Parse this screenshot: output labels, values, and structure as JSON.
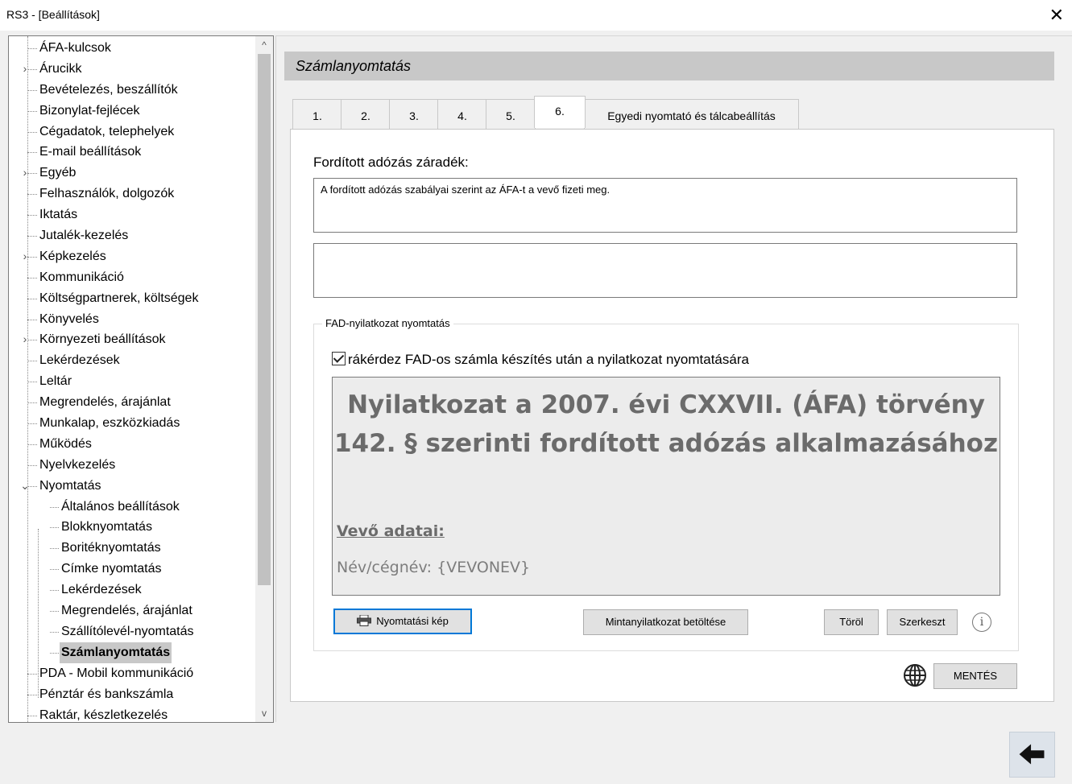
{
  "window": {
    "title": "RS3 - [Beállítások]",
    "close_label": "✕"
  },
  "tree": {
    "items": [
      {
        "label": "ÁFA-kulcsok",
        "level": 0,
        "expandable": false
      },
      {
        "label": "Árucikk",
        "level": 0,
        "expandable": true
      },
      {
        "label": "Bevételezés, beszállítók",
        "level": 0,
        "expandable": false
      },
      {
        "label": "Bizonylat-fejlécek",
        "level": 0,
        "expandable": false
      },
      {
        "label": "Cégadatok, telephelyek",
        "level": 0,
        "expandable": false
      },
      {
        "label": "E-mail beállítások",
        "level": 0,
        "expandable": false
      },
      {
        "label": "Egyéb",
        "level": 0,
        "expandable": true
      },
      {
        "label": "Felhasználók, dolgozók",
        "level": 0,
        "expandable": false
      },
      {
        "label": "Iktatás",
        "level": 0,
        "expandable": false
      },
      {
        "label": "Jutalék-kezelés",
        "level": 0,
        "expandable": false
      },
      {
        "label": "Képkezelés",
        "level": 0,
        "expandable": true
      },
      {
        "label": "Kommunikáció",
        "level": 0,
        "expandable": false
      },
      {
        "label": "Költségpartnerek, költségek",
        "level": 0,
        "expandable": false
      },
      {
        "label": "Könyvelés",
        "level": 0,
        "expandable": false
      },
      {
        "label": "Környezeti beállítások",
        "level": 0,
        "expandable": true
      },
      {
        "label": "Lekérdezések",
        "level": 0,
        "expandable": false
      },
      {
        "label": "Leltár",
        "level": 0,
        "expandable": false
      },
      {
        "label": "Megrendelés, árajánlat",
        "level": 0,
        "expandable": false
      },
      {
        "label": "Munkalap, eszközkiadás",
        "level": 0,
        "expandable": false
      },
      {
        "label": "Működés",
        "level": 0,
        "expandable": false
      },
      {
        "label": "Nyelvkezelés",
        "level": 0,
        "expandable": false
      },
      {
        "label": "Nyomtatás",
        "level": 0,
        "expandable": true,
        "expanded": true
      },
      {
        "label": "Általános beállítások",
        "level": 1,
        "expandable": false
      },
      {
        "label": "Blokknyomtatás",
        "level": 1,
        "expandable": false
      },
      {
        "label": "Boritéknyomtatás",
        "level": 1,
        "expandable": false
      },
      {
        "label": "Címke nyomtatás",
        "level": 1,
        "expandable": false
      },
      {
        "label": "Lekérdezések",
        "level": 1,
        "expandable": false
      },
      {
        "label": "Megrendelés, árajánlat",
        "level": 1,
        "expandable": false
      },
      {
        "label": "Szállítólevél-nyomtatás",
        "level": 1,
        "expandable": false
      },
      {
        "label": "Számlanyomtatás",
        "level": 1,
        "expandable": false,
        "selected": true
      },
      {
        "label": "PDA - Mobil kommunikáció",
        "level": 0,
        "expandable": false
      },
      {
        "label": "Pénztár és bankszámla",
        "level": 0,
        "expandable": false
      },
      {
        "label": "Raktár, készletkezelés",
        "level": 0,
        "expandable": false
      }
    ],
    "scroll_up": "^",
    "scroll_down": "v"
  },
  "main": {
    "section_title": "Számlanyomtatás",
    "tabs": [
      {
        "label": "1.",
        "active": false
      },
      {
        "label": "2.",
        "active": false
      },
      {
        "label": "3.",
        "active": false
      },
      {
        "label": "4.",
        "active": false
      },
      {
        "label": "5.",
        "active": false
      },
      {
        "label": "6.",
        "active": true
      },
      {
        "label": "Egyedi nyomtató és tálcabeállítás",
        "active": false
      }
    ],
    "reverse_charge_label": "Fordított adózás záradék:",
    "reverse_charge_text_1": "A fordított adózás szabályai szerint az ÁFA-t a vevő fizeti meg.",
    "reverse_charge_text_2": "",
    "fad_group": {
      "legend": "FAD-nyilatkozat nyomtatás",
      "checkbox_label": "rákérdez FAD-os számla készítés után a nyilatkozat nyomtatására",
      "checkbox_checked": true,
      "preview": {
        "heading": "Nyilatkozat a 2007. évi CXXVII. (ÁFA) törvény 142. § szerinti fordított adózás alkalmazásához",
        "buyer_title": "Vevő adatai:",
        "buyer_name": "Név/cégnév: {VEVONEV}"
      },
      "buttons": {
        "print_preview": "Nyomtatási kép",
        "load_sample": "Mintanyilatkozat betöltése",
        "delete": "Töröl",
        "edit": "Szerkeszt"
      },
      "info_glyph": "i"
    },
    "save_label": "MENTÉS"
  },
  "colors": {
    "accent": "#0078d7",
    "header_bg": "#c8c8c8",
    "window_bg": "#f0f0f0",
    "back_button_bg": "#dde3ea"
  }
}
